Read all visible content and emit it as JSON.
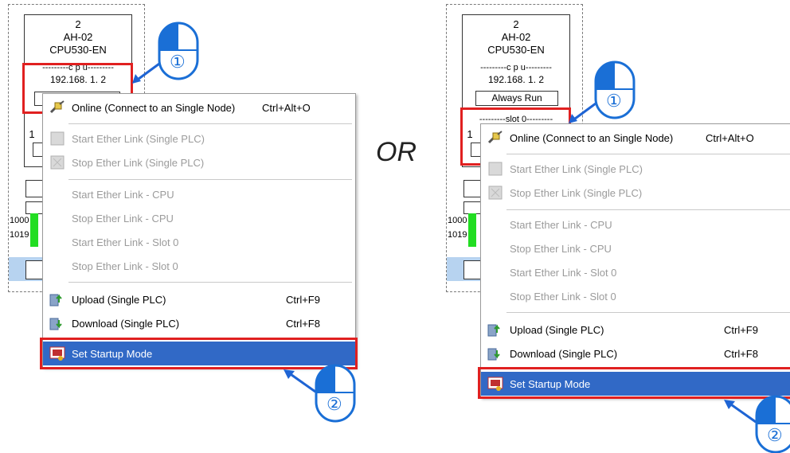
{
  "module": {
    "slot": "2",
    "model": "AH-02",
    "cpu_model": "CPU530-EN",
    "cpu_header": "---------c p u---------",
    "ip": "192.168.  1.  2",
    "run_mode": "Always Run",
    "slot_header": "---------slot 0---------",
    "partial_slot_char": "1"
  },
  "left_panel_labels": {
    "addr_1000": "1000",
    "addr_1019": "1019"
  },
  "right_panel_labels": {
    "addr_1000": "1000",
    "addr_1019": "1019"
  },
  "menu": {
    "items": [
      {
        "label": "Online (Connect to an Single Node)",
        "shortcut": "Ctrl+Alt+O",
        "enabled": true,
        "icon": "connect-plug-icon"
      },
      {
        "label": "Start Ether Link (Single PLC)",
        "enabled": false,
        "icon": "start-ether-link-icon"
      },
      {
        "label": "Stop Ether Link (Single PLC)",
        "enabled": false,
        "icon": "stop-ether-link-icon"
      },
      {
        "label": "Start Ether Link - CPU",
        "enabled": false
      },
      {
        "label": "Stop Ether Link - CPU",
        "enabled": false
      },
      {
        "label": "Start Ether Link - Slot 0",
        "enabled": false
      },
      {
        "label": "Stop Ether Link - Slot 0",
        "enabled": false
      },
      {
        "label": "Upload (Single PLC)",
        "shortcut": "Ctrl+F9",
        "enabled": true,
        "icon": "upload-icon"
      },
      {
        "label": "Download (Single PLC)",
        "shortcut": "Ctrl+F8",
        "enabled": true,
        "icon": "download-icon"
      },
      {
        "label": "Set Startup Mode",
        "enabled": true,
        "highlighted": true,
        "icon": "startup-mode-icon"
      }
    ]
  },
  "or_label": "OR",
  "step_markers": {
    "step1": "①",
    "step2": "②"
  },
  "colors": {
    "highlight": "#3169c6",
    "callout_red": "#e02020",
    "arrow_blue": "#1e64d4",
    "mouse_blue": "#1a6fd6"
  }
}
